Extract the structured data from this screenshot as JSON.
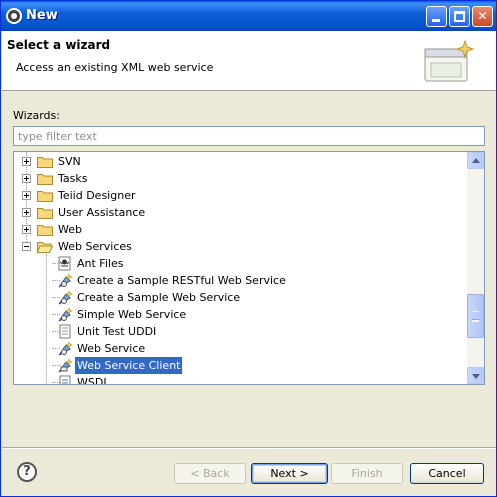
{
  "window": {
    "title": "New",
    "minimize_icon": "minimize-icon",
    "maximize_icon": "maximize-icon",
    "close_glyph": "✕"
  },
  "header": {
    "title": "Select a wizard",
    "description": "Access an existing XML web service"
  },
  "wizards": {
    "label": "Wizards:",
    "filter_placeholder": "type filter text",
    "filter_value": ""
  },
  "tree": {
    "items": [
      {
        "label": "SVN",
        "type": "folder",
        "level": 0,
        "expanded": false
      },
      {
        "label": "Tasks",
        "type": "folder",
        "level": 0,
        "expanded": false
      },
      {
        "label": "Teiid Designer",
        "type": "folder",
        "level": 0,
        "expanded": false
      },
      {
        "label": "User Assistance",
        "type": "folder",
        "level": 0,
        "expanded": false
      },
      {
        "label": "Web",
        "type": "folder",
        "level": 0,
        "expanded": false
      },
      {
        "label": "Web Services",
        "type": "folder",
        "level": 0,
        "expanded": true
      },
      {
        "label": "Ant Files",
        "type": "wizard",
        "level": 1,
        "icon": "ant-icon"
      },
      {
        "label": "Create a Sample RESTful Web Service",
        "type": "wizard",
        "level": 1,
        "icon": "webservice-wizard-icon"
      },
      {
        "label": "Create a Sample Web Service",
        "type": "wizard",
        "level": 1,
        "icon": "webservice-wizard-icon"
      },
      {
        "label": "Simple Web Service",
        "type": "wizard",
        "level": 1,
        "icon": "webservice-wizard-icon"
      },
      {
        "label": "Unit Test UDDI",
        "type": "wizard",
        "level": 1,
        "icon": "uddi-icon"
      },
      {
        "label": "Web Service",
        "type": "wizard",
        "level": 1,
        "icon": "webservice-wizard-icon"
      },
      {
        "label": "Web Service Client",
        "type": "wizard",
        "level": 1,
        "icon": "webservice-client-icon",
        "selected": true
      },
      {
        "label": "WSDL",
        "type": "wizard",
        "level": 1,
        "icon": "wsdl-icon"
      }
    ]
  },
  "buttons": {
    "help_glyph": "?",
    "back": "< Back",
    "next": "Next >",
    "finish": "Finish",
    "cancel": "Cancel"
  },
  "colors": {
    "titlebar": "#0553c9",
    "selection": "#316ac5",
    "dialog_bg": "#ece9d8"
  }
}
